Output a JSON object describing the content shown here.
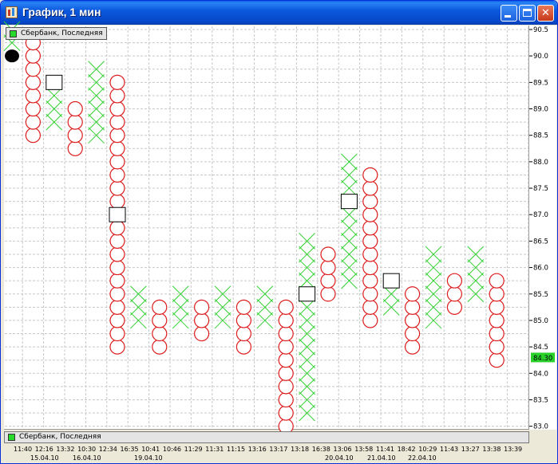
{
  "window": {
    "title": "График, 1 мин",
    "minimize_label": "",
    "maximize_label": "",
    "close_label": "✕"
  },
  "legend": {
    "label": "Сбербанк, Последняя",
    "color": "#26d92a"
  },
  "colors": {
    "x_mark": "#32d232",
    "o_mark": "#dd1c1c",
    "grid": "#c8c8c8",
    "current_price_bg": "#2bd12b"
  },
  "price_axis": {
    "labels": [
      "90.5",
      "90.0",
      "89.5",
      "89.0",
      "88.5",
      "88.0",
      "87.5",
      "87.0",
      "86.5",
      "86.0",
      "85.5",
      "85.0",
      "84.5",
      "84.0",
      "83.5",
      "83.0"
    ],
    "current_price": "84.30"
  },
  "time_axis": {
    "times": [
      "11:40",
      "12:16",
      "13:32",
      "10:30",
      "12:34",
      "16:35",
      "10:41",
      "10:46",
      "11:29",
      "11:31",
      "11:15",
      "13:16",
      "13:17",
      "13:18",
      "16:38",
      "13:06",
      "13:58",
      "11:41",
      "18:42",
      "10:29",
      "11:43",
      "13:27",
      "13:38",
      "13:39"
    ],
    "dates": [
      "15.04.10",
      "16.04.10",
      "19.04.10",
      "20.04.10",
      "21.04.10",
      "22.04.10"
    ]
  },
  "chart_data": {
    "type": "point-and-figure",
    "box_size": 0.25,
    "ylim": [
      83.0,
      90.5
    ],
    "columns": [
      {
        "type": "X",
        "low": 90.25,
        "high": 90.5
      },
      {
        "type": "O",
        "low": 88.5,
        "high": 90.25
      },
      {
        "type": "X",
        "low": 88.75,
        "high": 89.25
      },
      {
        "type": "O",
        "low": 88.25,
        "high": 89.0
      },
      {
        "type": "X",
        "low": 88.5,
        "high": 89.75
      },
      {
        "type": "O",
        "low": 84.5,
        "high": 89.5
      },
      {
        "type": "X",
        "low": 85.0,
        "high": 85.5
      },
      {
        "type": "O",
        "low": 84.5,
        "high": 85.25
      },
      {
        "type": "X",
        "low": 85.0,
        "high": 85.5
      },
      {
        "type": "O",
        "low": 84.75,
        "high": 85.25
      },
      {
        "type": "X",
        "low": 85.0,
        "high": 85.5
      },
      {
        "type": "O",
        "low": 84.5,
        "high": 85.25
      },
      {
        "type": "X",
        "low": 85.0,
        "high": 85.5
      },
      {
        "type": "O",
        "low": 83.0,
        "high": 85.25
      },
      {
        "type": "X",
        "low": 83.25,
        "high": 86.5
      },
      {
        "type": "O",
        "low": 85.5,
        "high": 86.25
      },
      {
        "type": "X",
        "low": 85.75,
        "high": 88.0
      },
      {
        "type": "O",
        "low": 85.0,
        "high": 87.75
      },
      {
        "type": "X",
        "low": 85.25,
        "high": 85.5
      },
      {
        "type": "O",
        "low": 84.5,
        "high": 85.5
      },
      {
        "type": "X",
        "low": 85.0,
        "high": 86.25
      },
      {
        "type": "O",
        "low": 85.25,
        "high": 85.75
      },
      {
        "type": "X",
        "low": 85.5,
        "high": 86.25
      },
      {
        "type": "O",
        "low": 84.25,
        "high": 85.75
      }
    ],
    "markers": [
      {
        "type": "filled-circle",
        "column": 0,
        "price": 90.0
      },
      {
        "type": "square",
        "column": 2,
        "price": 89.5
      },
      {
        "type": "square",
        "column": 5,
        "price": 87.0
      },
      {
        "type": "square",
        "column": 14,
        "price": 85.5
      },
      {
        "type": "square",
        "column": 16,
        "price": 87.25
      },
      {
        "type": "square",
        "column": 18,
        "price": 85.75
      }
    ]
  }
}
